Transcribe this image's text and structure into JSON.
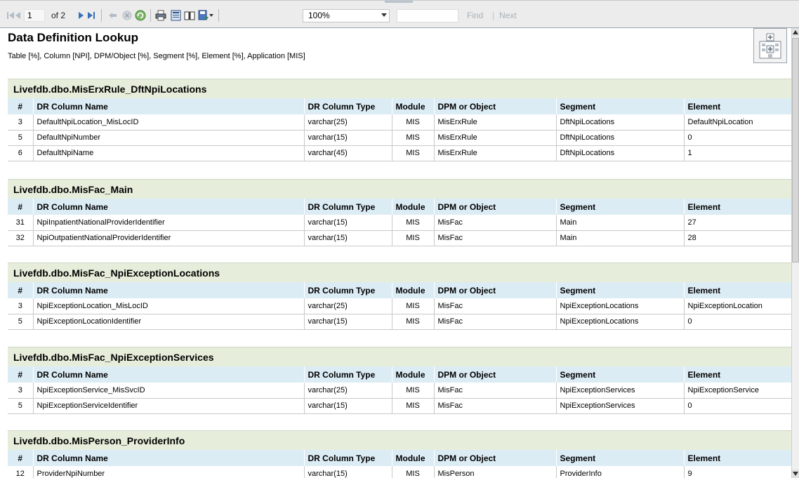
{
  "toolbar": {
    "page_current": "1",
    "page_of": "of 2",
    "zoom": "100%",
    "find_label": "Find",
    "find_separator": "|",
    "next_label": "Next",
    "icons": [
      "first-page",
      "previous-page",
      "next-page",
      "last-page",
      "back",
      "stop",
      "refresh",
      "print",
      "print-layout",
      "page-setup",
      "export"
    ]
  },
  "report": {
    "title": "Data Definition Lookup",
    "subtitle": "Table [%], Column [NPI], DPM/Object [%], Segment [%], Element [%], Application [MIS]"
  },
  "columns": [
    "#",
    "DR Column Name",
    "DR Column Type",
    "Module",
    "DPM or Object",
    "Segment",
    "Element"
  ],
  "sections": [
    {
      "name": "Livefdb.dbo.MisErxRule_DftNpiLocations",
      "rows": [
        [
          "3",
          "DefaultNpiLocation_MisLocID",
          "varchar(25)",
          "MIS",
          "MisErxRule",
          "DftNpiLocations",
          "DefaultNpiLocation"
        ],
        [
          "5",
          "DefaultNpiNumber",
          "varchar(15)",
          "MIS",
          "MisErxRule",
          "DftNpiLocations",
          "0"
        ],
        [
          "6",
          "DefaultNpiName",
          "varchar(45)",
          "MIS",
          "MisErxRule",
          "DftNpiLocations",
          "1"
        ]
      ]
    },
    {
      "name": "Livefdb.dbo.MisFac_Main",
      "rows": [
        [
          "31",
          "NpiInpatientNationalProviderIdentifier",
          "varchar(15)",
          "MIS",
          "MisFac",
          "Main",
          "27"
        ],
        [
          "32",
          "NpiOutpatientNationalProviderIdentifier",
          "varchar(15)",
          "MIS",
          "MisFac",
          "Main",
          "28"
        ]
      ]
    },
    {
      "name": "Livefdb.dbo.MisFac_NpiExceptionLocations",
      "rows": [
        [
          "3",
          "NpiExceptionLocation_MisLocID",
          "varchar(25)",
          "MIS",
          "MisFac",
          "NpiExceptionLocations",
          "NpiExceptionLocation"
        ],
        [
          "5",
          "NpiExceptionLocationIdentifier",
          "varchar(15)",
          "MIS",
          "MisFac",
          "NpiExceptionLocations",
          "0"
        ]
      ]
    },
    {
      "name": "Livefdb.dbo.MisFac_NpiExceptionServices",
      "rows": [
        [
          "3",
          "NpiExceptionService_MisSvcID",
          "varchar(25)",
          "MIS",
          "MisFac",
          "NpiExceptionServices",
          "NpiExceptionService"
        ],
        [
          "5",
          "NpiExceptionServiceIdentifier",
          "varchar(15)",
          "MIS",
          "MisFac",
          "NpiExceptionServices",
          "0"
        ]
      ]
    },
    {
      "name": "Livefdb.dbo.MisPerson_ProviderInfo",
      "rows": [
        [
          "12",
          "ProviderNpiNumber",
          "varchar(15)",
          "MIS",
          "MisPerson",
          "ProviderInfo",
          "9"
        ]
      ]
    }
  ],
  "colors": {
    "section_header_bg": "#e6eedb",
    "column_header_bg": "#dcecf5",
    "toolbar_bg": "#ececec",
    "icon_disabled": "#aab3be",
    "icon_blue": "#3b6fb6"
  }
}
